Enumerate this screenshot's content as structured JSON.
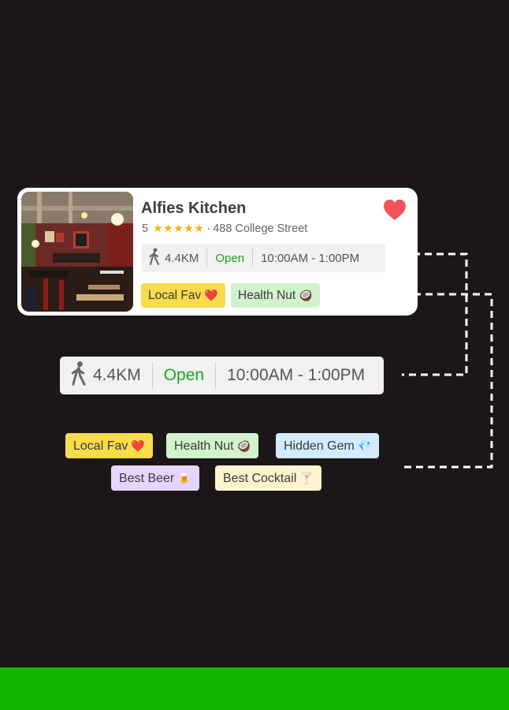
{
  "card": {
    "name": "Alfies Kitchen",
    "rating": "5",
    "stars": "★★★★★",
    "separator": "·",
    "address": "488 College Street",
    "favorited": true,
    "info": {
      "distance": "4.4KM",
      "status": "Open",
      "hours": "10:00AM - 1:00PM"
    },
    "tags": [
      {
        "label": "Local Fav",
        "emoji": "❤️"
      },
      {
        "label": "Health Nut",
        "emoji": "🥥"
      }
    ]
  },
  "info_detail": {
    "distance": "4.4KM",
    "status": "Open",
    "hours": "10:00AM - 1:00PM"
  },
  "tag_set": [
    {
      "label": "Local Fav",
      "emoji": "❤️"
    },
    {
      "label": "Health Nut",
      "emoji": "🥥"
    },
    {
      "label": "Hidden Gem",
      "emoji": "💎"
    },
    {
      "label": "Best Beer",
      "emoji": "🍺"
    },
    {
      "label": "Best Cocktail",
      "emoji": "🍸"
    }
  ],
  "colors": {
    "background": "#1b1718",
    "open_green": "#19a61d",
    "star_gold": "#f5b400",
    "heart_red": "#f2545b",
    "footer_green": "#11b500"
  },
  "icons": {
    "walking": "walking-person-icon",
    "favorite": "heart-icon"
  }
}
